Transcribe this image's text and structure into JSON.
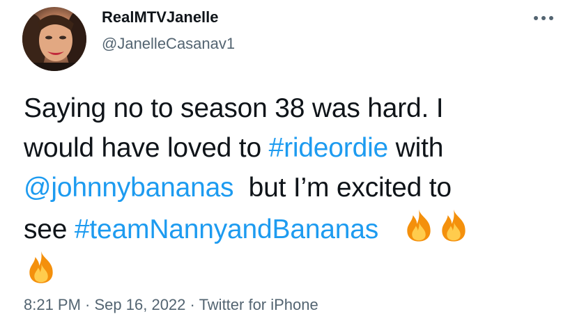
{
  "user": {
    "display_name": "RealMTVJanelle",
    "handle": "@JanelleCasanav1",
    "avatar_icon": "profile-photo"
  },
  "more_icon": "more-horizontal-icon",
  "tweet": {
    "line1": "Saying no to season 38 was hard. I",
    "line2_pre": "would have loved to ",
    "hashtag1": "#rideordie",
    "line2_post": " with",
    "mention": "@johnnybananas",
    "line3_post": "  but I’m excited to",
    "line4_pre": "see ",
    "hashtag2": "#teamNannyandBananas",
    "emoji_icon": "fire-emoji"
  },
  "meta": {
    "time": "8:21 PM",
    "sep1": " · ",
    "date": "Sep 16, 2022",
    "sep2": " · ",
    "source": "Twitter for iPhone"
  },
  "colors": {
    "text": "#0f1419",
    "secondary": "#536471",
    "link": "#1d9bf0"
  }
}
